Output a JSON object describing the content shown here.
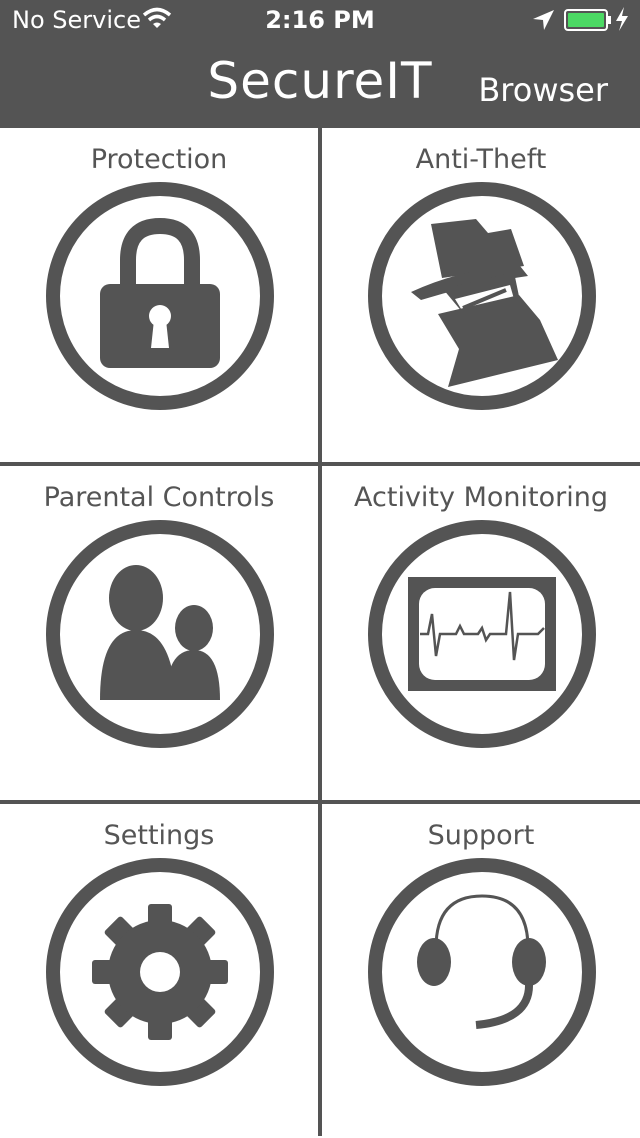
{
  "status_bar": {
    "carrier": "No Service",
    "time": "2:16 PM",
    "wifi_icon": "wifi-icon",
    "location_icon": "location-arrow-icon",
    "battery_icon": "battery-icon",
    "charging_icon": "charging-bolt-icon",
    "battery_color": "#4cd964"
  },
  "header": {
    "title": "SecureIT",
    "browser_label": "Browser"
  },
  "tiles": [
    {
      "label": "Protection",
      "icon": "padlock-icon"
    },
    {
      "label": "Anti-Theft",
      "icon": "spy-icon"
    },
    {
      "label": "Parental Controls",
      "icon": "parent-child-icon"
    },
    {
      "label": "Activity Monitoring",
      "icon": "heartbeat-monitor-icon"
    },
    {
      "label": "Settings",
      "icon": "gear-icon"
    },
    {
      "label": "Support",
      "icon": "headset-icon"
    }
  ],
  "colors": {
    "header_bg": "#545454",
    "icon_gray": "#545454",
    "label_gray": "#555555",
    "background": "#ffffff"
  }
}
